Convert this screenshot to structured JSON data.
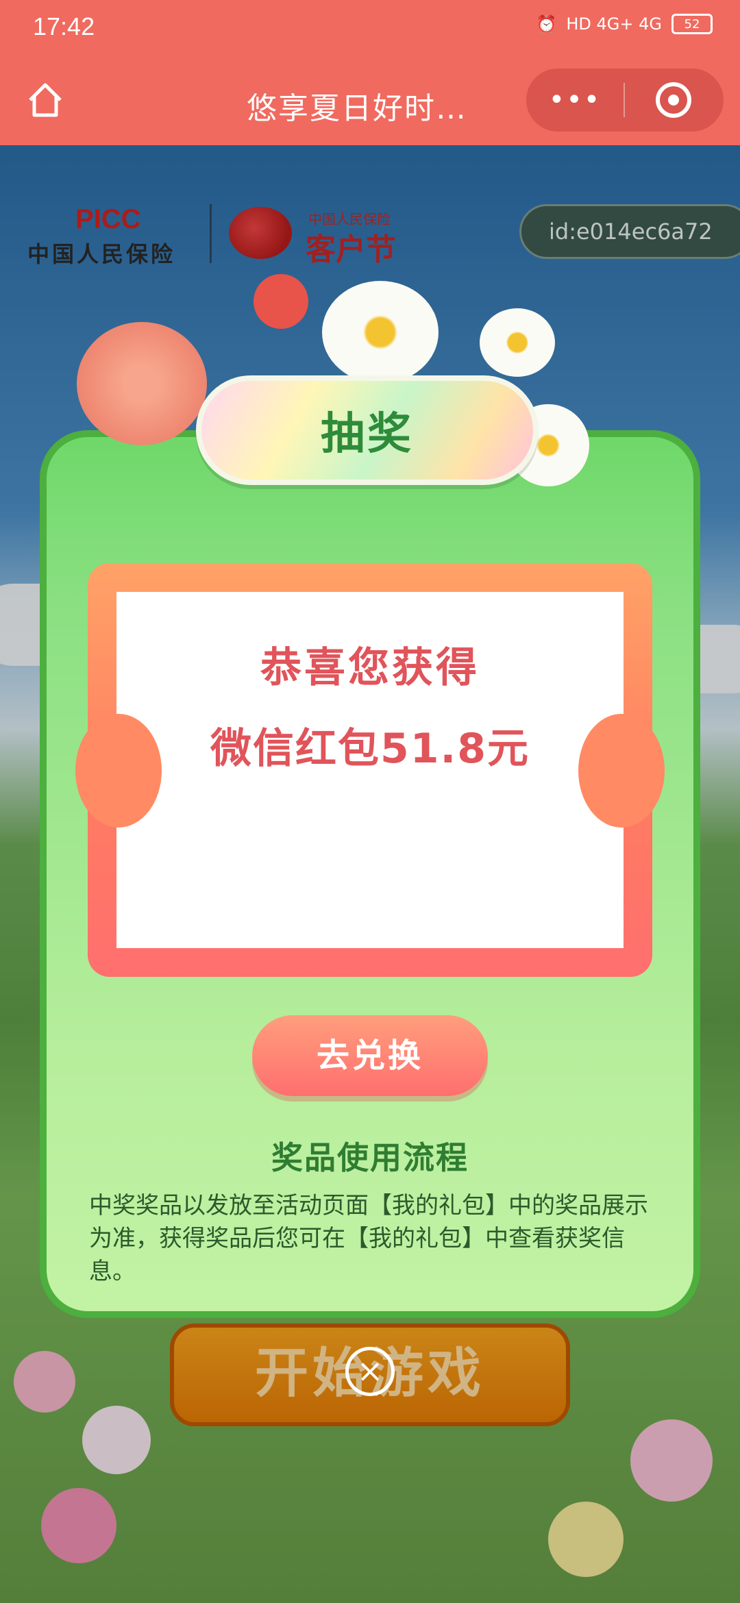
{
  "status_bar": {
    "time": "17:42",
    "network": "HD 4G+ 4G",
    "battery": "52"
  },
  "title_bar": {
    "title": "悠享夏日好时…",
    "more_label": "•••"
  },
  "logos": {
    "picc_en": "PICC",
    "picc_cn": "中国人民保险",
    "festival_small": "中国人民保险",
    "festival_big": "客户节"
  },
  "user": {
    "id": "id:e014ec6a72"
  },
  "modal": {
    "header": "抽奖",
    "congrats": "恭喜您获得",
    "prize": "微信红包51.8元",
    "redeem_button": "去兑换",
    "flow_title": "奖品使用流程",
    "flow_text": "中奖奖品以发放至活动页面【我的礼包】中的奖品展示为准，获得奖品后您可在【我的礼包】中查看获奖信息。"
  },
  "start_button": "开始游戏",
  "colors": {
    "titlebar": "#f06a5f",
    "modal_green": "#8be082",
    "prize_red": "#e0545a"
  }
}
